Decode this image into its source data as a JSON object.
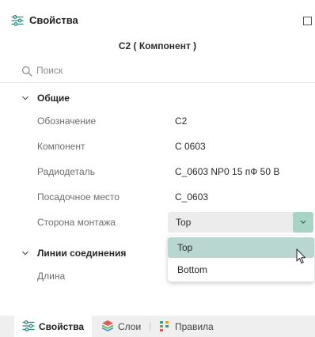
{
  "header": {
    "title": "Свойства"
  },
  "subtitle": "C2 ( Компонент )",
  "search": {
    "placeholder": "Поиск",
    "value": ""
  },
  "groups": [
    {
      "label": "Общие",
      "expanded": true,
      "properties": [
        {
          "name": "Обозначение",
          "value": "C2"
        },
        {
          "name": "Компонент",
          "value": "C 0603"
        },
        {
          "name": "Радиодеталь",
          "value": "C_0603 NP0 15 пФ 50 В"
        },
        {
          "name": "Посадочное место",
          "value": "C_0603"
        },
        {
          "name": "Сторона монтажа",
          "value": "Top"
        }
      ]
    },
    {
      "label": "Линии соединения",
      "expanded": true,
      "properties": [
        {
          "name": "Длина",
          "value": ""
        }
      ]
    }
  ],
  "dropdown": {
    "options": [
      "Top",
      "Bottom"
    ],
    "selected": "Top"
  },
  "tabs": [
    {
      "label": "Свойства",
      "icon": "sliders-icon",
      "active": true
    },
    {
      "label": "Слои",
      "icon": "layers-icon",
      "active": false
    },
    {
      "label": "Правила",
      "icon": "rules-icon",
      "active": false
    }
  ],
  "colors": {
    "accent": "#a8d4c6",
    "option_highlight": "#b9d6d0",
    "icon_teal": "#3a9a8c",
    "layers_green": "#56b84c",
    "layers_red": "#e05a5a"
  }
}
